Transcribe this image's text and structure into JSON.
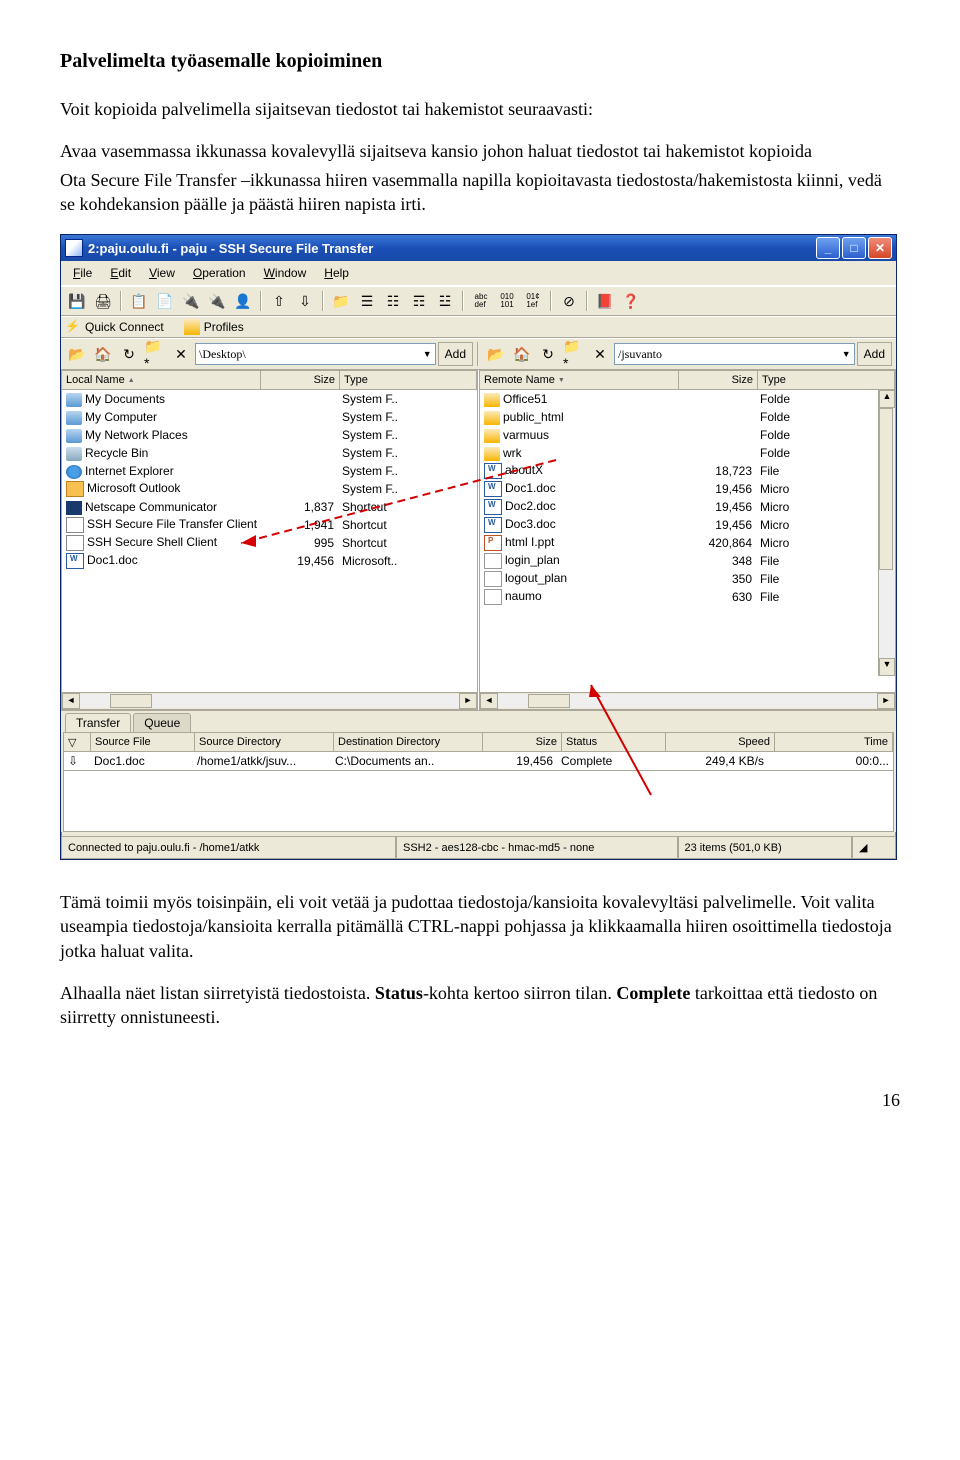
{
  "doc": {
    "heading": "Palvelimelta työasemalle kopioiminen",
    "p1": "Voit kopioida palvelimella sijaitsevan tiedostot tai hakemistot seuraavasti:",
    "p2a": "Avaa vasemmassa ikkunassa kovalevyllä sijaitseva kansio johon haluat tiedostot tai hakemistot kopioida",
    "p2b": "Ota Secure File Transfer –ikkunassa hiiren vasemmalla napilla kopioitavasta tiedostosta/hakemistosta kiinni, vedä se kohdekansion päälle ja päästä hiiren napista irti.",
    "p3": "Tämä toimii myös toisinpäin, eli voit vetää ja pudottaa tiedostoja/kansioita kovalevyltäsi palvelimelle. Voit valita useampia tiedostoja/kansioita kerralla pitämällä CTRL-nappi pohjassa ja klikkaamalla hiiren osoittimella tiedostoja jotka haluat valita.",
    "p4a": "Alhaalla näet listan siirretyistä tiedostoista. ",
    "p4b": "Status",
    "p4c": "-kohta kertoo siirron tilan. ",
    "p4d": "Complete",
    "p4e": " tarkoittaa että tiedosto on siirretty onnistuneesti.",
    "pagenum": "16"
  },
  "window": {
    "title": "2:paju.oulu.fi - paju - SSH Secure File Transfer",
    "menus": {
      "file": "File",
      "edit": "Edit",
      "view": "View",
      "operation": "Operation",
      "window": "Window",
      "help": "Help"
    },
    "quick": {
      "connect": "Quick Connect",
      "profiles": "Profiles"
    },
    "nav": {
      "left_path": "\\Desktop\\",
      "right_path": "/jsuvanto",
      "add": "Add"
    },
    "cols": {
      "localname": "Local Name",
      "remotename": "Remote Name",
      "size": "Size",
      "type": "Type"
    },
    "local_files": [
      {
        "icon": "ic-sysfolder",
        "name": "My Documents",
        "size": "",
        "type": "System F.."
      },
      {
        "icon": "ic-sysfolder",
        "name": "My Computer",
        "size": "",
        "type": "System F.."
      },
      {
        "icon": "ic-sysfolder",
        "name": "My Network Places",
        "size": "",
        "type": "System F.."
      },
      {
        "icon": "ic-recycle",
        "name": "Recycle Bin",
        "size": "",
        "type": "System F.."
      },
      {
        "icon": "ic-ie",
        "name": "Internet Explorer",
        "size": "",
        "type": "System F.."
      },
      {
        "icon": "ic-outlook",
        "name": "Microsoft Outlook",
        "size": "",
        "type": "System F.."
      },
      {
        "icon": "ic-netscape",
        "name": "Netscape Communicator",
        "size": "1,837",
        "type": "Shortcut"
      },
      {
        "icon": "ic-link",
        "name": "SSH Secure File Transfer Client",
        "size": "1,941",
        "type": "Shortcut"
      },
      {
        "icon": "ic-link",
        "name": "SSH Secure Shell Client",
        "size": "995",
        "type": "Shortcut"
      },
      {
        "icon": "ic-doc-w",
        "name": "Doc1.doc",
        "size": "19,456",
        "type": "Microsoft.."
      }
    ],
    "remote_files": [
      {
        "icon": "ic-folder",
        "name": "Office51",
        "size": "",
        "type": "Folde"
      },
      {
        "icon": "ic-folder",
        "name": "public_html",
        "size": "",
        "type": "Folde"
      },
      {
        "icon": "ic-folder",
        "name": "varmuus",
        "size": "",
        "type": "Folde"
      },
      {
        "icon": "ic-folder",
        "name": "wrk",
        "size": "",
        "type": "Folde"
      },
      {
        "icon": "ic-doc-w",
        "name": "aboutX",
        "size": "18,723",
        "type": "File"
      },
      {
        "icon": "ic-doc-w",
        "name": "Doc1.doc",
        "size": "19,456",
        "type": "Micro"
      },
      {
        "icon": "ic-doc-w",
        "name": "Doc2.doc",
        "size": "19,456",
        "type": "Micro"
      },
      {
        "icon": "ic-doc-w",
        "name": "Doc3.doc",
        "size": "19,456",
        "type": "Micro"
      },
      {
        "icon": "ic-ppt",
        "name": "html I.ppt",
        "size": "420,864",
        "type": "Micro"
      },
      {
        "icon": "ic-generic",
        "name": "login_plan",
        "size": "348",
        "type": "File"
      },
      {
        "icon": "ic-generic",
        "name": "logout_plan",
        "size": "350",
        "type": "File"
      },
      {
        "icon": "ic-generic",
        "name": "naumo",
        "size": "630",
        "type": "File"
      }
    ],
    "tabs": {
      "transfer": "Transfer",
      "queue": "Queue"
    },
    "tcols": {
      "src": "Source File",
      "srcdir": "Source Directory",
      "dstdir": "Destination Directory",
      "size": "Size",
      "status": "Status",
      "speed": "Speed",
      "time": "Time"
    },
    "trow": {
      "src": "Doc1.doc",
      "srcdir": "/home1/atkk/jsuv...",
      "dstdir": "C:\\Documents an..",
      "size": "19,456",
      "status": "Complete",
      "speed": "249,4 KB/s",
      "time": "00:0..."
    },
    "status": {
      "conn": "Connected to paju.oulu.fi - /home1/atkk",
      "enc": "SSH2 - aes128-cbc - hmac-md5 - none",
      "items": "23 items (501,0 KB)"
    }
  }
}
